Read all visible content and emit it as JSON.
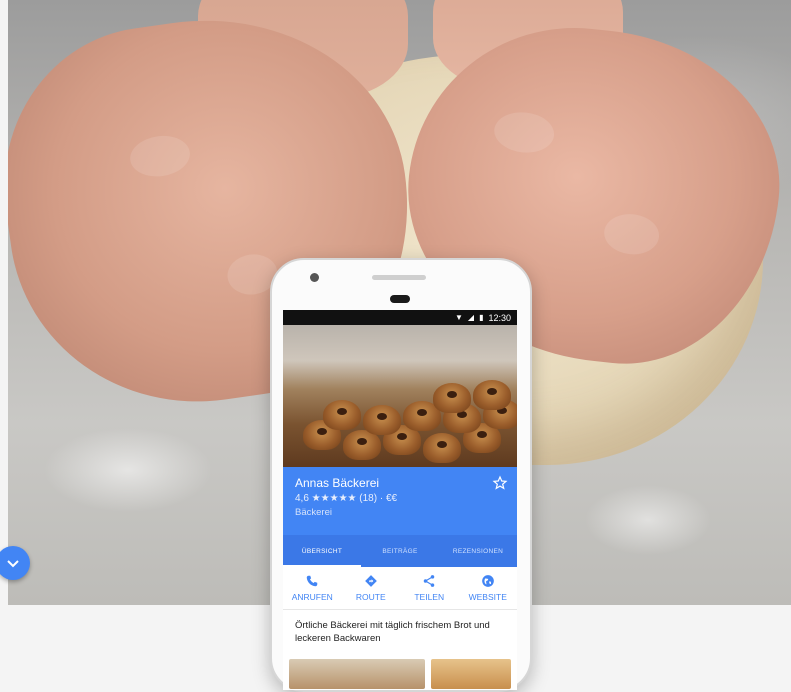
{
  "hero": {
    "image": "hands-kneading-dough-photo"
  },
  "scroll_button": {
    "icon": "chevron-down-icon"
  },
  "phone": {
    "status_bar": {
      "time": "12:30"
    },
    "listing": {
      "name": "Annas Bäckerei",
      "rating_line": "4,6 ★★★★★ (18) · €€",
      "category": "Bäckerei",
      "save_icon": "star-outline-icon"
    },
    "tabs": [
      {
        "label": "ÜBERSICHT",
        "active": true
      },
      {
        "label": "BEITRÄGE",
        "active": false
      },
      {
        "label": "REZENSIONEN",
        "active": false
      }
    ],
    "actions": [
      {
        "label": "ANRUFEN",
        "icon": "phone-icon"
      },
      {
        "label": "ROUTE",
        "icon": "directions-icon"
      },
      {
        "label": "TEILEN",
        "icon": "share-icon"
      },
      {
        "label": "WEBSITE",
        "icon": "globe-icon"
      }
    ],
    "description": "Örtliche Bäckerei mit täglich frischem Brot und leckeren Backwaren"
  },
  "colors": {
    "accent": "#4285f4",
    "tab_bar": "#3b78e7"
  }
}
